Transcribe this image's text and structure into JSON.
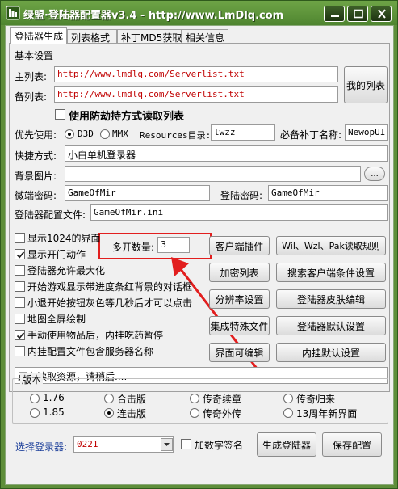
{
  "window": {
    "title": "绿盟·登陆器配置器v3.4 - http://www.LmDlq.com",
    "accent_color": "#5e8e3a"
  },
  "tabs": [
    "登陆器生成",
    "列表格式",
    "补丁MD5获取",
    "相关信息"
  ],
  "basic": {
    "section_label": "基本设置",
    "main_list_label": "主列表:",
    "main_list_value": "http://www.lmdlq.com/Serverlist.txt",
    "backup_list_label": "备列表:",
    "backup_list_value": "http://www.lmdlq.com/Serverlist.txt",
    "my_list_button": "我的列表",
    "anti_hijack_label": "使用防劫持方式读取列表",
    "priority_label": "优先使用:",
    "d3d_label": "D3D",
    "mmx_label": "MMX",
    "resources_label": "Resources目录:",
    "resources_value": "lwzz",
    "patch_label": "必备补丁名称:",
    "patch_value": "NewopUI",
    "shortcut_label": "快捷方式:",
    "shortcut_value": "小白单机登录器",
    "bg_label": "背景图片:",
    "bg_value": "",
    "browse_button": "...",
    "micro_pwd_label": "微端密码:",
    "micro_pwd_value": "GameOfMir",
    "login_pwd_label": "登陆密码:",
    "login_pwd_value": "GameOfMir",
    "config_file_label": "登陆器配置文件:",
    "config_file_value": "GameOfMir.ini"
  },
  "options": [
    {
      "label": "显示1024的界面",
      "checked": false
    },
    {
      "label": "显示开门动作",
      "checked": true
    },
    {
      "label": "登陆器允许最大化",
      "checked": false
    },
    {
      "label": "开始游戏显示带进度条红背景的对话框",
      "checked": false
    },
    {
      "label": "小退开始按钮灰色等几秒后才可以点击",
      "checked": false
    },
    {
      "label": "地图全屏绘制",
      "checked": false
    },
    {
      "label": "手动使用物品后，内挂吃药暂停",
      "checked": true
    },
    {
      "label": "内挂配置文件包含服务器名称",
      "checked": false
    }
  ],
  "multi_open": {
    "label": "多开数量:",
    "value": "3"
  },
  "buttons": {
    "client_plugin": "客户端插件",
    "wil_rule": "Wil、Wzl、Pak读取规则",
    "encrypt_list": "加密列表",
    "search_client": "搜索客户端条件设置",
    "resolution": "分辨率设置",
    "skin_edit": "登陆器皮肤编辑",
    "special_file": "集成特殊文件",
    "default_settings": "登陆器默认设置",
    "ui_edit": "界面可编辑",
    "plugin_default": "内挂默认设置"
  },
  "status": "正在读取资源，请稍后....",
  "version": {
    "label": "版本",
    "options": [
      {
        "label": "1.76",
        "selected": false
      },
      {
        "label": "合击版",
        "selected": false
      },
      {
        "label": "传奇续章",
        "selected": false
      },
      {
        "label": "传奇归来",
        "selected": false
      },
      {
        "label": "1.85",
        "selected": false
      },
      {
        "label": "连击版",
        "selected": true
      },
      {
        "label": "传奇外传",
        "selected": false
      },
      {
        "label": "13周年新界面",
        "selected": false
      }
    ]
  },
  "bottom": {
    "select_label": "选择登录器:",
    "select_value": "0221",
    "digital_sign_label": "加数字签名",
    "generate_button": "生成登陆器",
    "save_button": "保存配置"
  }
}
